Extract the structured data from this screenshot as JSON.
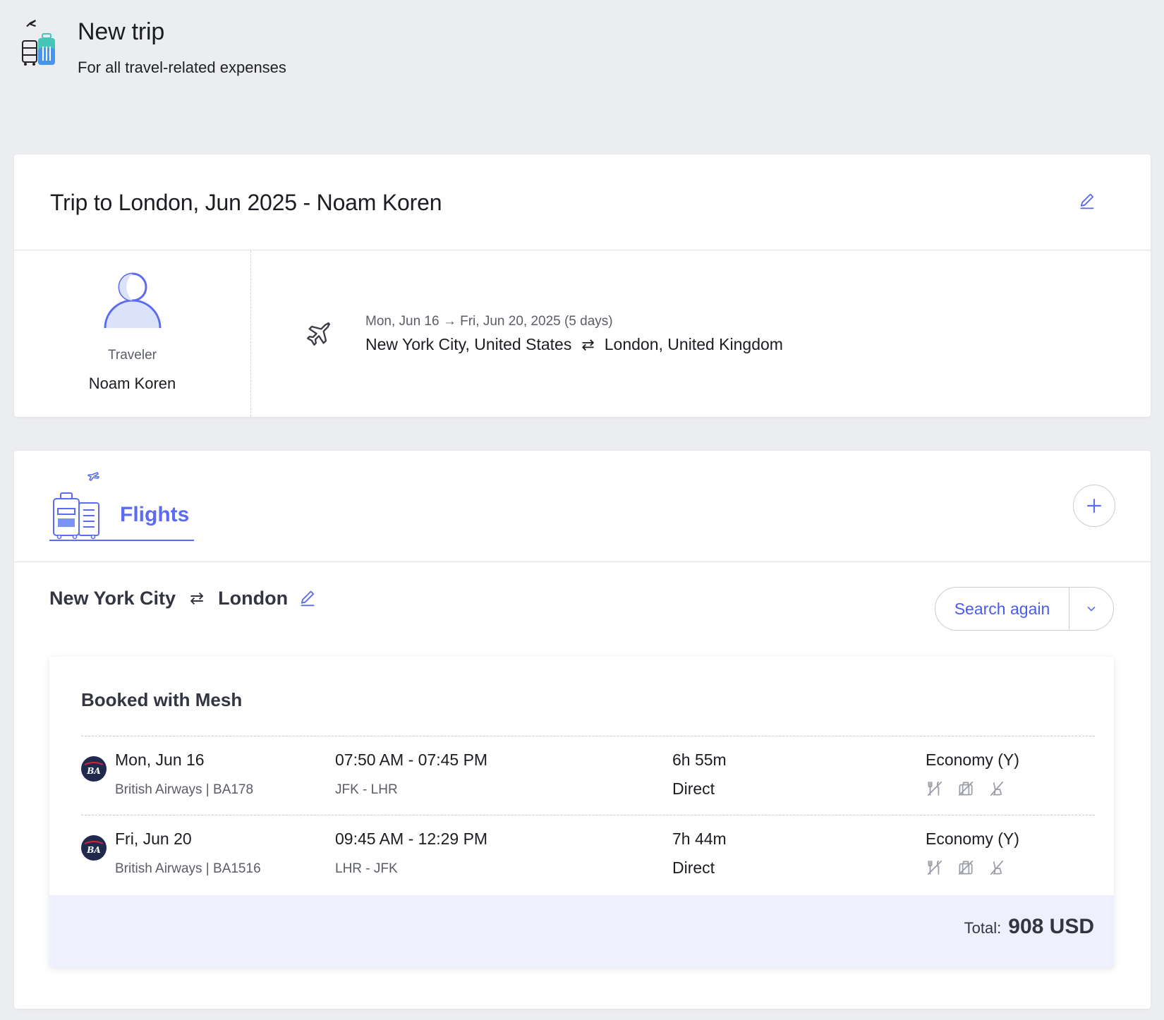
{
  "header": {
    "title": "New trip",
    "subtitle": "For all travel-related expenses",
    "icon": "suitcase-plane-icon"
  },
  "trip": {
    "title": "Trip to London, Jun 2025 - Noam Koren",
    "traveler_label": "Traveler",
    "traveler_name": "Noam Koren",
    "dates": "Mon, Jun 16 → Fri, Jun 20, 2025 (5 days)",
    "origin": "New York City, United States",
    "destination": "London, United Kingdom",
    "swap_glyph": "⇄"
  },
  "flights": {
    "tab_label": "Flights",
    "route_from": "New York City",
    "route_to": "London",
    "swap_glyph": "⇄",
    "search_label": "Search again",
    "booking_title": "Booked with Mesh",
    "legs": [
      {
        "date": "Mon, Jun 16",
        "airline": "British Airways | BA178",
        "times": "07:50 AM - 07:45 PM",
        "airports": "JFK - LHR",
        "duration": "6h 55m",
        "stops": "Direct",
        "cabin": "Economy (Y)",
        "logo_text": "BA"
      },
      {
        "date": "Fri, Jun 20",
        "airline": "British Airways | BA1516",
        "times": "09:45 AM - 12:29 PM",
        "airports": "LHR - JFK",
        "duration": "7h 44m",
        "stops": "Direct",
        "cabin": "Economy (Y)",
        "logo_text": "BA"
      }
    ],
    "total_label": "Total:",
    "total_value": "908 USD"
  },
  "colors": {
    "accent": "#5b6cf2",
    "background": "#ecedf1",
    "total_bar": "#eef1fd",
    "airline_logo": "#1f2a4d"
  }
}
